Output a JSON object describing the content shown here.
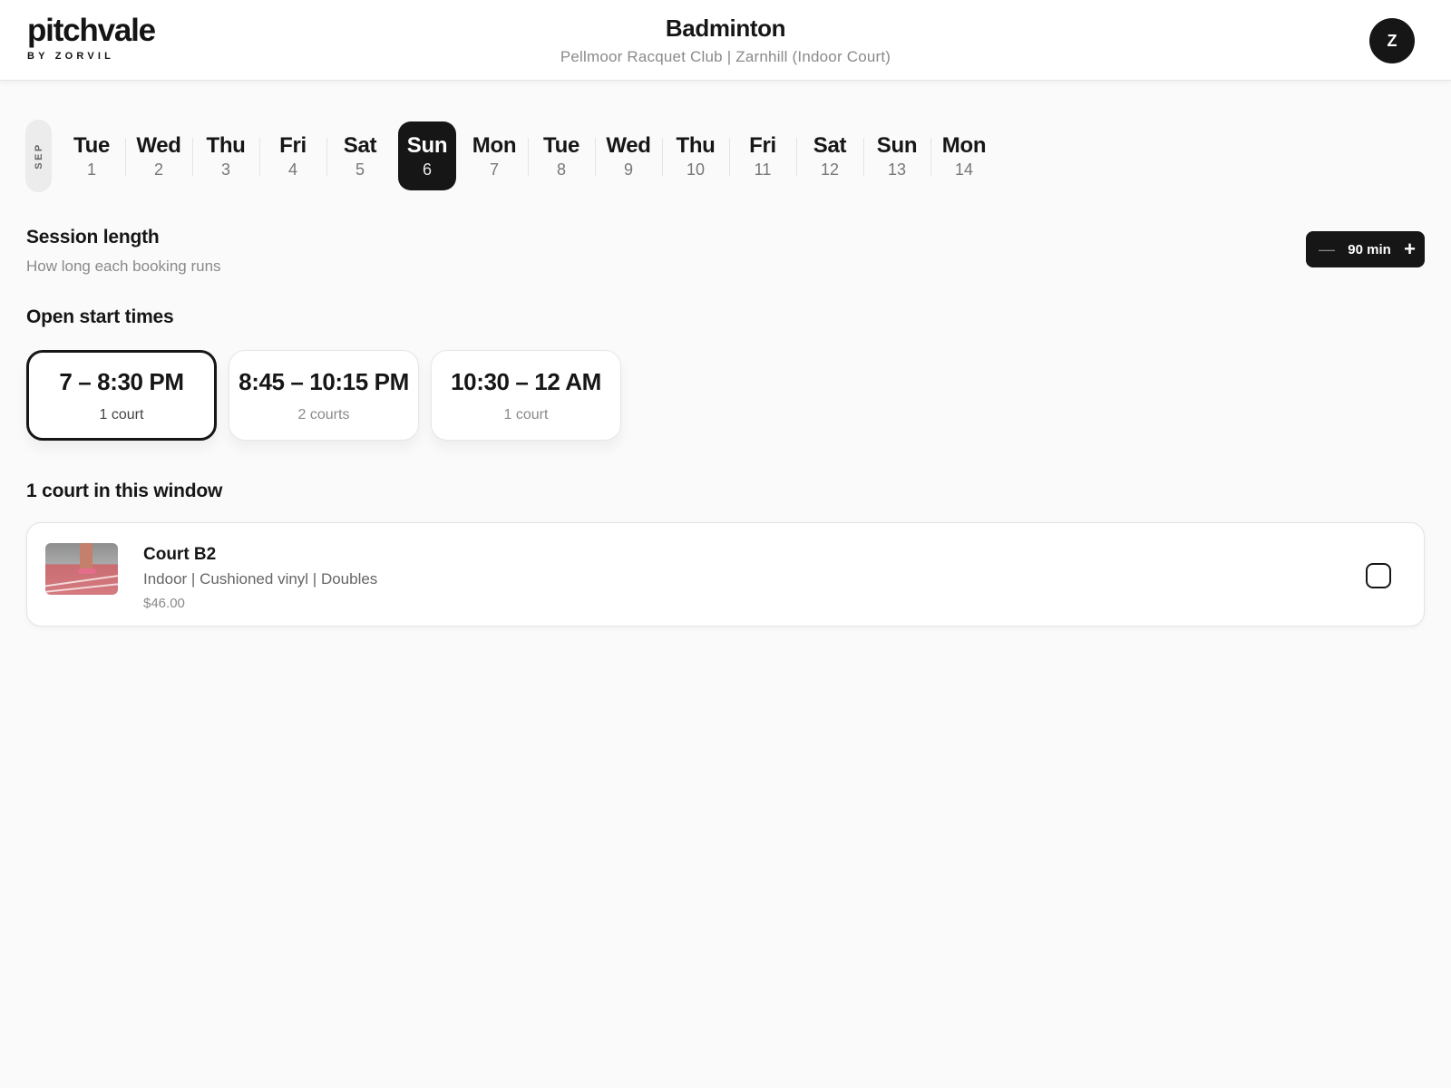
{
  "brand": {
    "name": "pitchvale",
    "tagline": "BY ZORVIL"
  },
  "header": {
    "title": "Badminton",
    "subtitle": "Pellmoor Racquet Club | Zarnhill (Indoor Court)",
    "avatar_initial": "Z"
  },
  "calendar": {
    "month": "SEP",
    "selected_index": 5,
    "days": [
      {
        "name": "Tue",
        "num": "1"
      },
      {
        "name": "Wed",
        "num": "2"
      },
      {
        "name": "Thu",
        "num": "3"
      },
      {
        "name": "Fri",
        "num": "4"
      },
      {
        "name": "Sat",
        "num": "5"
      },
      {
        "name": "Sun",
        "num": "6"
      },
      {
        "name": "Mon",
        "num": "7"
      },
      {
        "name": "Tue",
        "num": "8"
      },
      {
        "name": "Wed",
        "num": "9"
      },
      {
        "name": "Thu",
        "num": "10"
      },
      {
        "name": "Fri",
        "num": "11"
      },
      {
        "name": "Sat",
        "num": "12"
      },
      {
        "name": "Sun",
        "num": "13"
      },
      {
        "name": "Mon",
        "num": "14"
      }
    ]
  },
  "session": {
    "title": "Session length",
    "subtitle": "How long each booking runs",
    "minus_glyph": "—",
    "value": "90 min",
    "plus_glyph": "+"
  },
  "start_times": {
    "title": "Open start times",
    "selected_index": 0,
    "slots": [
      {
        "time": "7 – 8:30 PM",
        "count": "1 court"
      },
      {
        "time": "8:45 – 10:15 PM",
        "count": "2 courts"
      },
      {
        "time": "10:30 – 12 AM",
        "count": "1 court"
      }
    ]
  },
  "window": {
    "title": "1 court in this window",
    "courts": [
      {
        "name": "Court B2",
        "meta": "Indoor | Cushioned vinyl | Doubles",
        "price": "$46.00",
        "checked": false
      }
    ]
  },
  "colors": {
    "accent": "#161616",
    "muted_text": "#8a8a8a",
    "background": "#fafafa"
  }
}
